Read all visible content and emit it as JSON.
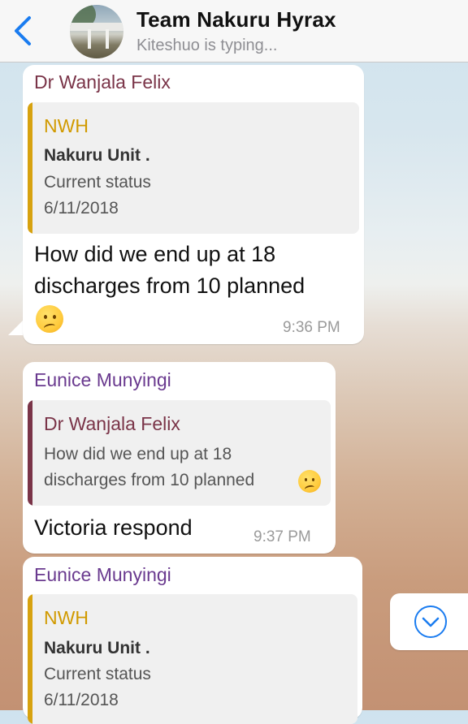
{
  "header": {
    "title": "Team Nakuru Hyrax",
    "subtitle": "Kiteshuo is typing...",
    "back_icon": "chevron-left-icon",
    "accent": "#1a7cf0"
  },
  "messages": [
    {
      "sender": "Dr Wanjala Felix",
      "sender_color": "#7a3448",
      "quote": {
        "title": "NWH",
        "title_color": "#d19a00",
        "bar_color": "#d7a20f",
        "line1": "Nakuru Unit .",
        "line2": "Current status",
        "line3": "6/11/2018"
      },
      "text_line1": "How did we end up at 18",
      "text_line2": "discharges from 10 planned",
      "emoji": "confused-face",
      "time": "9:36 PM"
    },
    {
      "sender": "Eunice Munyingi",
      "sender_color": "#6a3a8f",
      "quote": {
        "title": "Dr Wanjala Felix",
        "title_color": "#7a3448",
        "bar_color": "#7a3448",
        "line1": "How did we end up at 18",
        "line2": "discharges from 10 planned"
      },
      "text": "Victoria respond",
      "time": "9:37 PM"
    },
    {
      "sender": "Eunice Munyingi",
      "sender_color": "#6a3a8f",
      "quote": {
        "title": "NWH",
        "title_color": "#d19a00",
        "bar_color": "#d7a20f",
        "line1": "Nakuru Unit .",
        "line2": "Current status",
        "line3": "6/11/2018"
      }
    }
  ],
  "scroll_button": {
    "icon": "chevron-down-circle-icon"
  }
}
